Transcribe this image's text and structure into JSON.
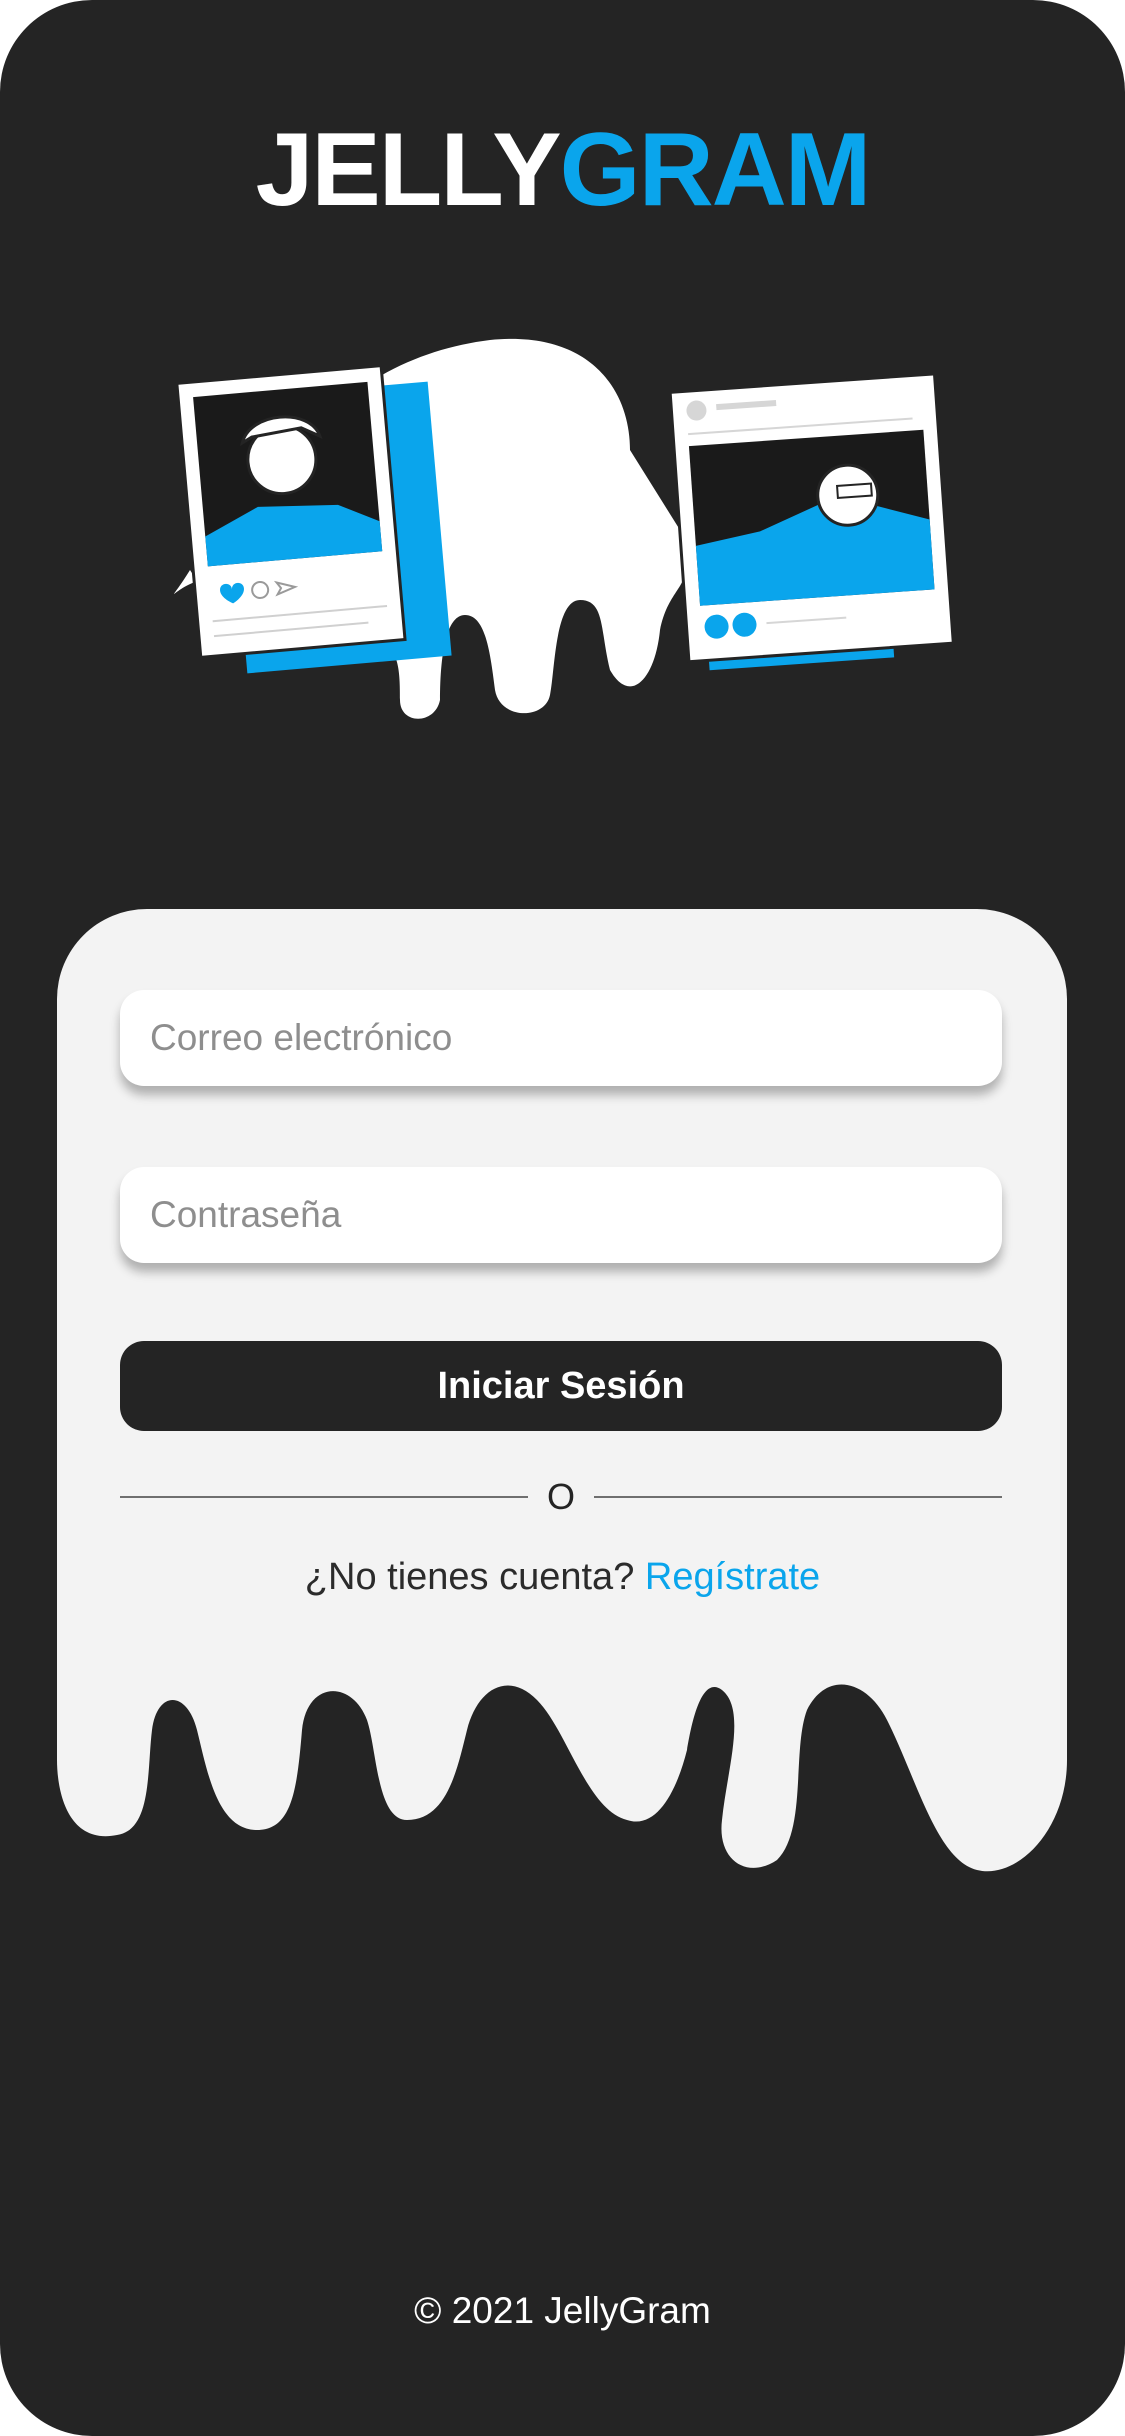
{
  "brand": {
    "part1": "JELLY",
    "part2": "GRAM",
    "color_primary": "#0aa5ec",
    "color_dark": "#242424"
  },
  "form": {
    "email_placeholder": "Correo electrónico",
    "password_placeholder": "Contraseña",
    "submit_label": "Iniciar Sesión",
    "divider_text": "O",
    "no_account_text": "¿No tienes cuenta?",
    "register_link": "Regístrate"
  },
  "footer": {
    "copyright": "© 2021 JellyGram"
  },
  "illustration": {
    "icons": [
      "heart-icon",
      "comment-icon",
      "send-icon",
      "like-thumb-icon",
      "heart-badge-icon"
    ]
  }
}
